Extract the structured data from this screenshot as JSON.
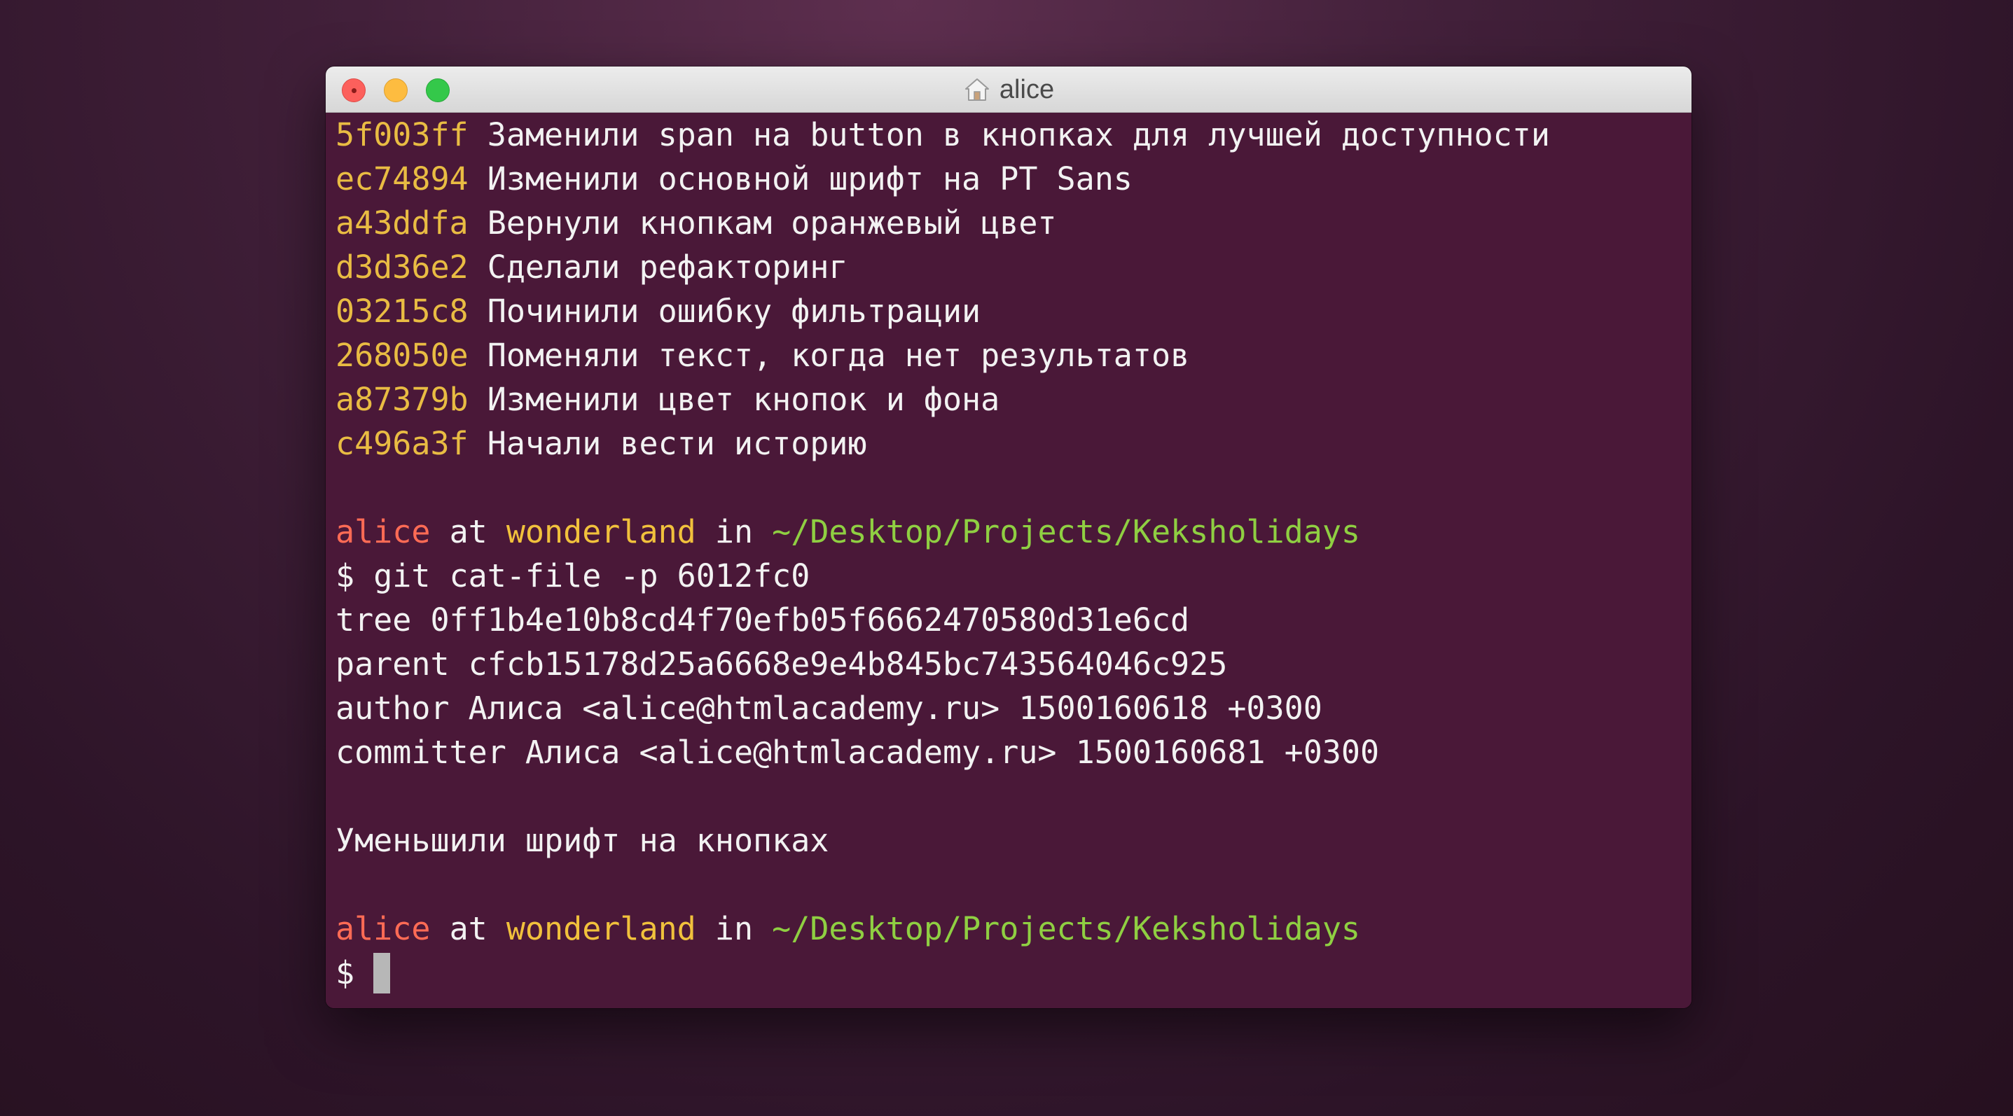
{
  "window": {
    "title": "alice",
    "title_icon": "home-icon"
  },
  "log": [
    {
      "hash": "5f003ff",
      "message": "Заменили span на button в кнопках для лучшей доступности"
    },
    {
      "hash": "ec74894",
      "message": "Изменили основной шрифт на PT Sans"
    },
    {
      "hash": "a43ddfa",
      "message": "Вернули кнопкам оранжевый цвет"
    },
    {
      "hash": "d3d36e2",
      "message": "Сделали рефакторинг"
    },
    {
      "hash": "03215c8",
      "message": "Починили ошибку фильтрации"
    },
    {
      "hash": "268050e",
      "message": "Поменяли текст, когда нет результатов"
    },
    {
      "hash": "a87379b",
      "message": "Изменили цвет кнопок и фона"
    },
    {
      "hash": "c496a3f",
      "message": "Начали вести историю"
    }
  ],
  "prompt": {
    "user": "alice",
    "at": "at",
    "host": "wonderland",
    "in": "in",
    "path": "~/Desktop/Projects/Keksholidays",
    "symbol": "$"
  },
  "command": "git cat-file -p 6012fc0",
  "output": [
    "tree 0ff1b4e10b8cd4f70efb05f6662470580d31e6cd",
    "parent cfcb15178d25a6668e9e4b845bc743564046c925",
    "author Алиса <alice@htmlacademy.ru> 1500160618 +0300",
    "committer Алиса <alice@htmlacademy.ru> 1500160681 +0300"
  ],
  "commit_message": "Уменьшили шрифт на кнопках",
  "colors": {
    "terminal_bg": "#4a1838",
    "hash": "#e9bc43",
    "user": "#ff6b55",
    "host": "#f1c13c",
    "path": "#8fcf42",
    "text": "#f2f2f2"
  }
}
